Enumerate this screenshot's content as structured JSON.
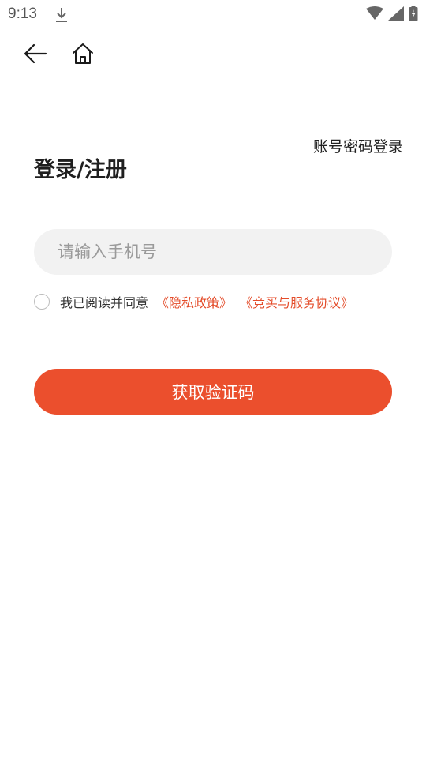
{
  "status_bar": {
    "time": "9:13",
    "icons": [
      "download-icon",
      "wifi-icon",
      "cell-signal-icon",
      "battery-icon"
    ]
  },
  "nav": {
    "back_icon": "back-arrow-icon",
    "home_icon": "home-icon"
  },
  "header": {
    "account_login_label": "账号密码登录",
    "title": "登录/注册"
  },
  "form": {
    "phone_placeholder": "请输入手机号",
    "phone_value": "",
    "agree_text": "我已阅读并同意",
    "privacy_link": "《隐私政策》",
    "service_link": "《竞买与服务协议》",
    "submit_label": "获取验证码"
  },
  "colors": {
    "accent": "#eb4f2d",
    "link": "#e44d2b",
    "input_bg": "#f2f2f2"
  }
}
